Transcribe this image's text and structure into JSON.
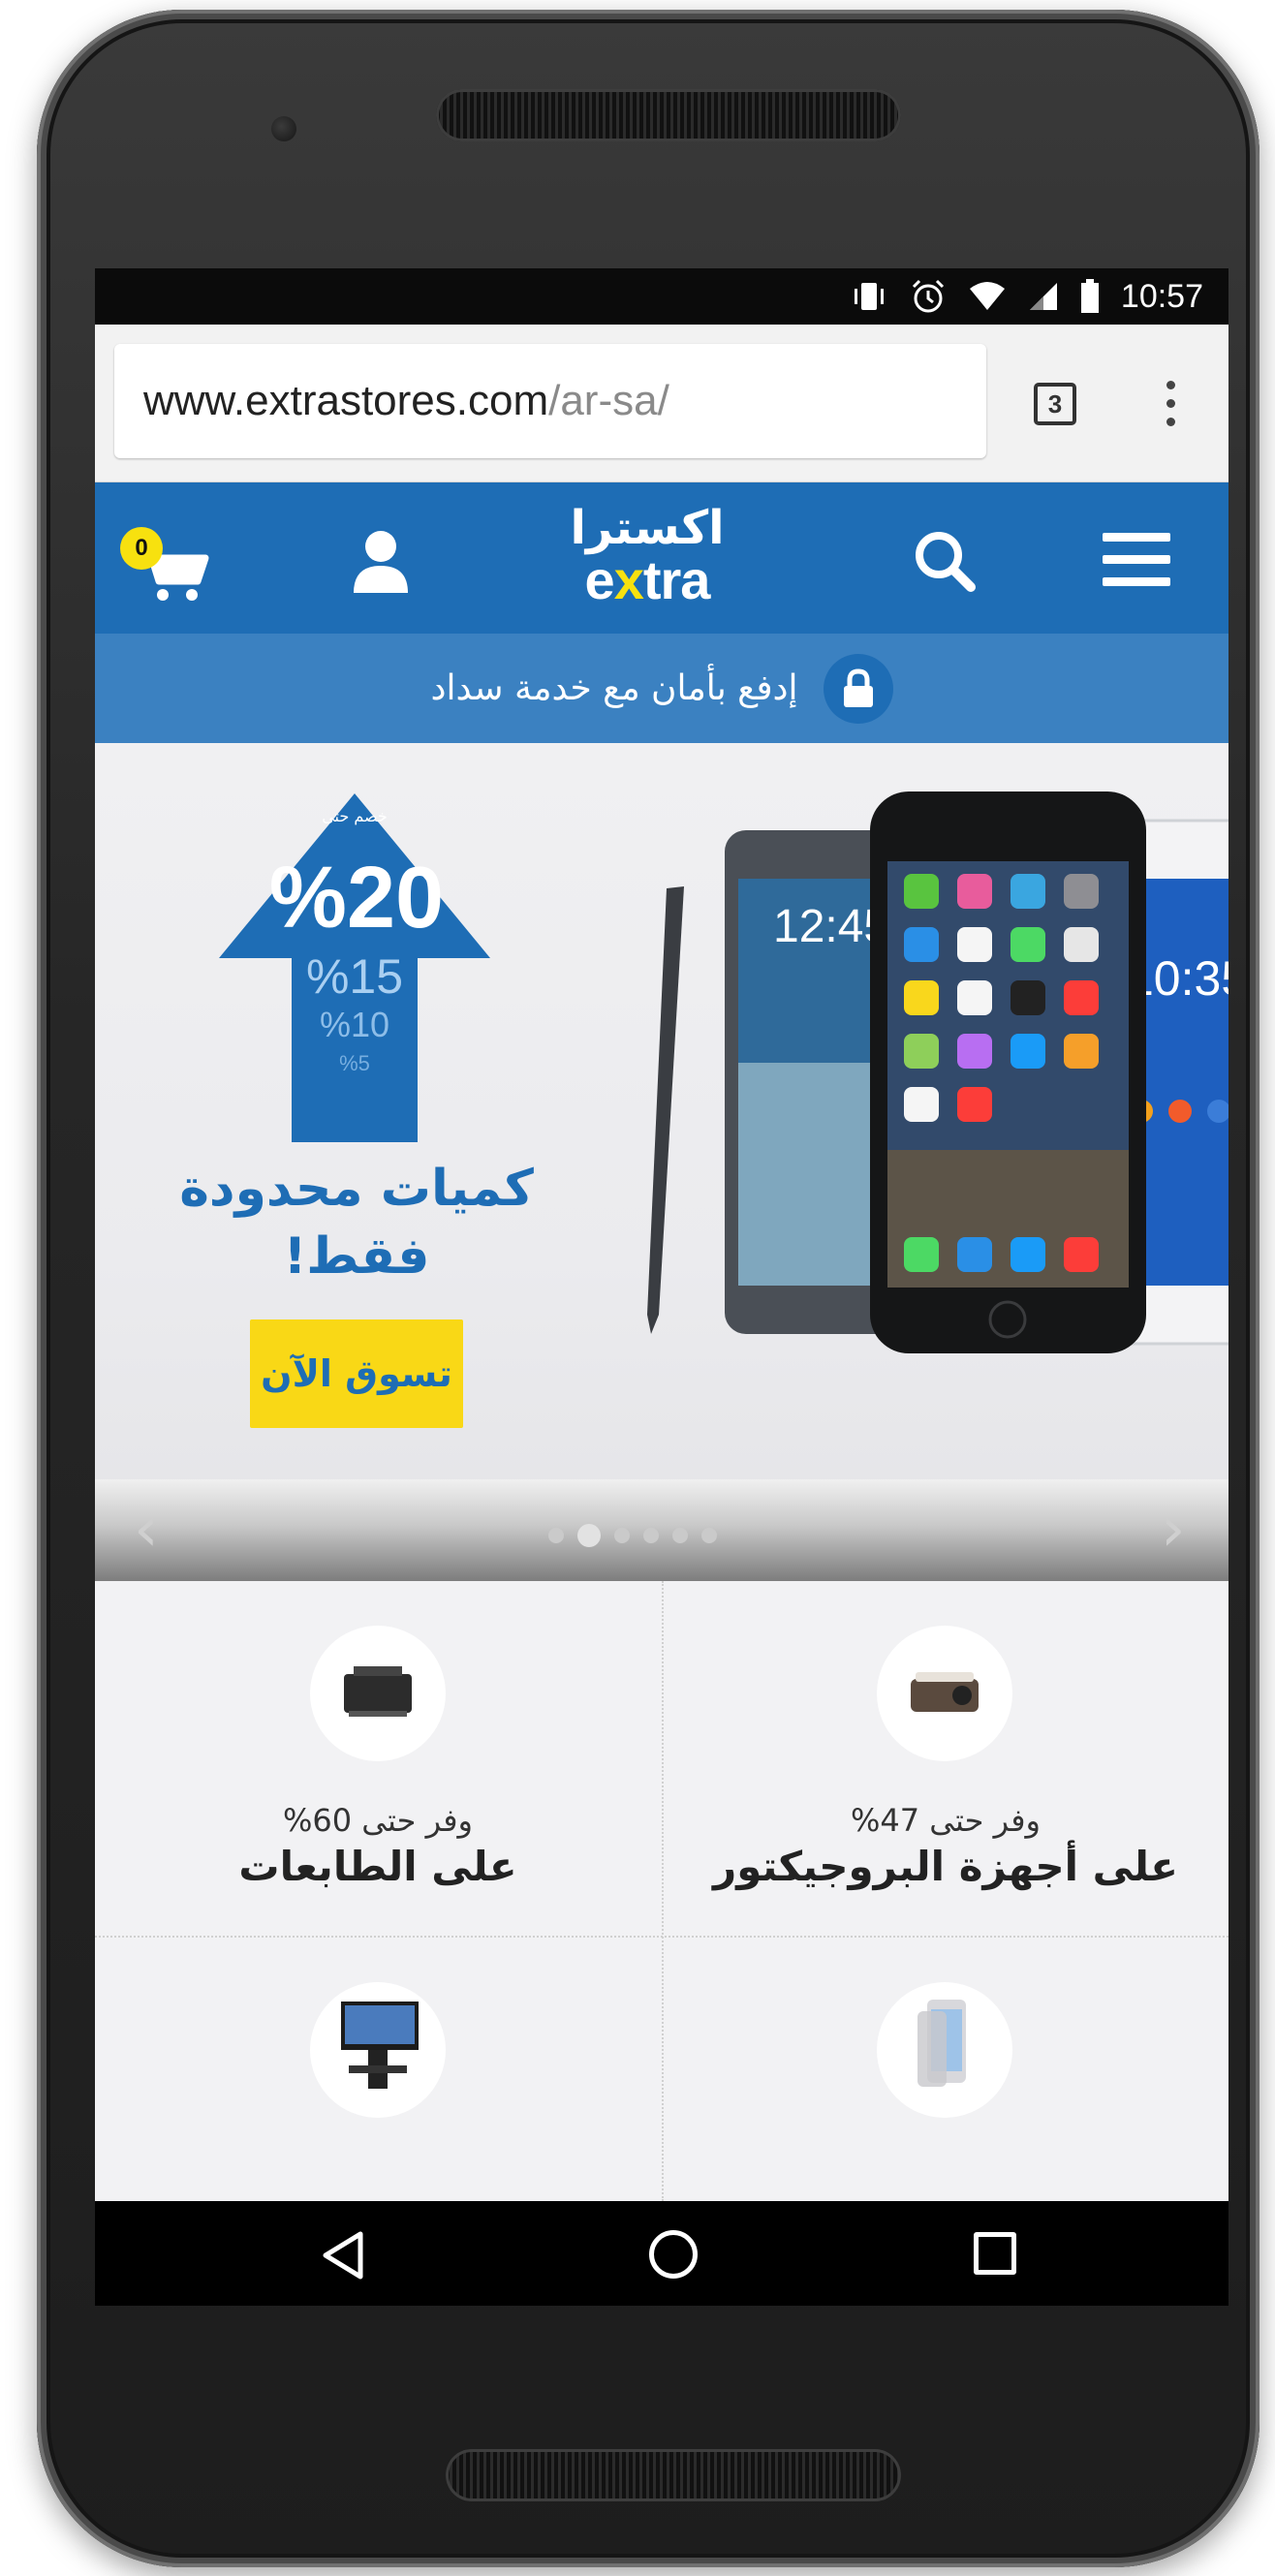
{
  "status_bar": {
    "time": "10:57",
    "icons": [
      "vibrate-icon",
      "alarm-icon",
      "wifi-icon",
      "signal-icon",
      "battery-icon"
    ]
  },
  "browser": {
    "url_domain": "www.extrastores.com",
    "url_path": "/ar-sa/",
    "tab_count": "3",
    "menu_icon": "more-vert-icon"
  },
  "header": {
    "cart_count": "0",
    "logo_ar": "اكسترا",
    "logo_en_before": "e",
    "logo_en_x": "x",
    "logo_en_after": "tra",
    "icons": [
      "cart-icon",
      "user-icon",
      "search-icon",
      "hamburger-menu-icon"
    ],
    "brand_color": "#1e6db5",
    "accent_color": "#f7e10f"
  },
  "secure_banner": {
    "text": "إدفع بأمان مع خدمة سداد",
    "icon": "lock-icon",
    "background": "#3b81c1"
  },
  "promo_banner": {
    "tag": "خصم حتى",
    "discount_main": "%20",
    "discount_2": "%15",
    "discount_3": "%10",
    "discount_4": "%5",
    "headline_line1": "كميات محدودة",
    "headline_line2": "فقط!",
    "cta_label": "تسوق الآن",
    "cta_color": "#f9d816",
    "phone_time_1": "12:45",
    "phone_time_2": "10:35"
  },
  "carousel": {
    "prev_icon": "chevron-left-icon",
    "next_icon": "chevron-right-icon",
    "slide_count": 6,
    "active_index": 1
  },
  "deals": [
    {
      "subtitle": "وفر حتى 60%",
      "title": "على الطابعات",
      "icon": "printer-icon"
    },
    {
      "subtitle": "وفر حتى 47%",
      "title": "على أجهزة البروجيكتور",
      "icon": "projector-icon"
    },
    {
      "subtitle": "",
      "title": "",
      "icon": "tv-stand-icon"
    },
    {
      "subtitle": "",
      "title": "",
      "icon": "smartphone-icon"
    }
  ],
  "nav_bar": {
    "icons": [
      "back-icon",
      "home-icon",
      "recent-apps-icon"
    ]
  }
}
